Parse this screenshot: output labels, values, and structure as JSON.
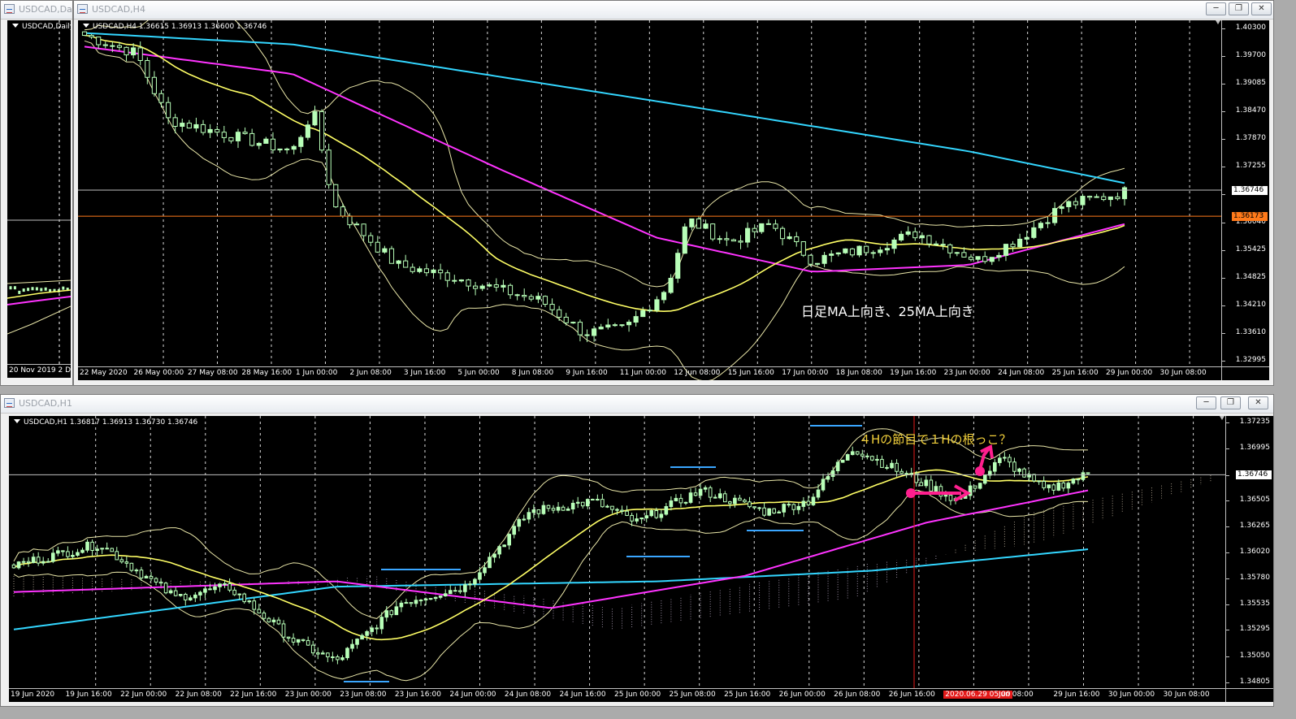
{
  "daily": {
    "title": "USDCAD,Daily",
    "symbol_line": "USDCAD,Daily",
    "date_label": "20 Nov 2019   2 D"
  },
  "h4": {
    "title": "USDCAD,H4",
    "symbol_line": "USDCAD,H4  1.36615 1.36913 1.36600 1.36746",
    "price_labels": [
      "1.40300",
      "1.39700",
      "1.39085",
      "1.38470",
      "1.37870",
      "1.37255",
      "1.36655",
      "1.36040",
      "1.35425",
      "1.34825",
      "1.34210",
      "1.33610",
      "1.32995"
    ],
    "current_price": "1.36746",
    "hline_price": "1.36173",
    "time_labels": [
      "22 May 2020",
      "26 May 00:00",
      "27 May 08:00",
      "28 May 16:00",
      "1 Jun 00:00",
      "2 Jun 08:00",
      "3 Jun 16:00",
      "5 Jun 00:00",
      "8 Jun 08:00",
      "9 Jun 16:00",
      "11 Jun 00:00",
      "12 Jun 08:00",
      "15 Jun 16:00",
      "17 Jun 00:00",
      "18 Jun 08:00",
      "19 Jun 16:00",
      "23 Jun 00:00",
      "24 Jun 08:00",
      "25 Jun 16:00",
      "29 Jun 00:00",
      "30 Jun 08:00"
    ],
    "annotation": "日足MA上向き、25MA上向き"
  },
  "h1": {
    "title": "USDCAD,H1",
    "symbol_line": "USDCAD,H1  1.36817 1.36913 1.36730 1.36746",
    "price_labels": [
      "1.37235",
      "1.36995",
      "1.36745",
      "1.36505",
      "1.36265",
      "1.36020",
      "1.35780",
      "1.35535",
      "1.35295",
      "1.35050",
      "1.34805"
    ],
    "current_price": "1.36746",
    "time_labels": [
      "19 Jun 2020",
      "19 Jun 16:00",
      "22 Jun 00:00",
      "22 Jun 08:00",
      "22 Jun 16:00",
      "23 Jun 00:00",
      "23 Jun 08:00",
      "23 Jun 16:00",
      "24 Jun 00:00",
      "24 Jun 08:00",
      "24 Jun 16:00",
      "25 Jun 00:00",
      "25 Jun 08:00",
      "25 Jun 16:00",
      "26 Jun 00:00",
      "26 Jun 08:00",
      "26 Jun 16:00",
      "2020.06.29 05:00",
      "Jun 08:00",
      "29 Jun 16:00",
      "30 Jun 00:00",
      "30 Jun 08:00"
    ],
    "annotation": "４Hの節目で１Hの根っこ？"
  },
  "colors": {
    "candle": "#b8ffb8",
    "ma_yellow": "#ffff66",
    "ma_magenta": "#ff33ff",
    "ma_cyan": "#33d6ff",
    "bollinger": "#e9e6a8",
    "hline_orange": "#ff7a1a",
    "annotation_pink": "#ff1f8e",
    "annotation_gold": "#f2d03b",
    "crosshair_red": "#e31a1a",
    "blue_marks": "#3aa6ff"
  }
}
